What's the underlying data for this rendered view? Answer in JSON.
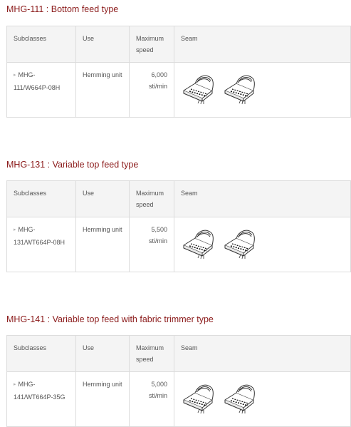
{
  "headers": {
    "subclasses": "Subclasses",
    "use": "Use",
    "speed": "Maximum speed",
    "seam": "Seam"
  },
  "sections": [
    {
      "title": "MHG-111 : Bottom feed type",
      "subclass": "MHG-111/W664P-08H",
      "use": "Hemming unit",
      "speed_value": "6,000",
      "speed_unit": "sti/min"
    },
    {
      "title": "MHG-131 : Variable top feed type",
      "subclass": "MHG-131/WT664P-08H",
      "use": "Hemming unit",
      "speed_value": "5,500",
      "speed_unit": "sti/min"
    },
    {
      "title": "MHG-141 : Variable top feed with fabric trimmer type",
      "subclass": "MHG-141/WT664P-35G",
      "use": "Hemming unit",
      "speed_value": "5,000",
      "speed_unit": "sti/min"
    }
  ],
  "colors": {
    "title": "#8b1a1a",
    "text": "#555555",
    "header_bg": "#f4f4f4",
    "border": "#dcdcdc"
  },
  "icons": [
    "seam-hem-illustration-icon",
    "seam-hem-illustration-icon"
  ]
}
